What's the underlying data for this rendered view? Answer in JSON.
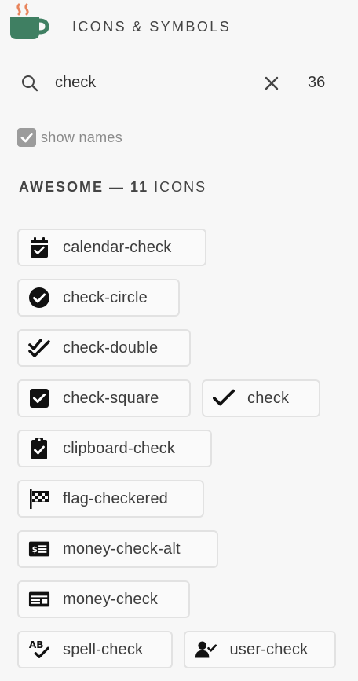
{
  "header": {
    "title": "ICONS & SYMBOLS",
    "logo_icon": "coffee-cup-icon"
  },
  "search": {
    "value": "check",
    "placeholder": "",
    "size": "36"
  },
  "options": {
    "show_names_label": "show names",
    "show_names_checked": true
  },
  "section": {
    "set_name": "AWESOME",
    "separator": "—",
    "count_label": "11",
    "unit": "ICONS"
  },
  "colors": {
    "logo_cup": "#3f7f62",
    "logo_steam": "#e8845c",
    "checkbox": "#9c9c9c"
  },
  "icons": [
    {
      "name": "calendar-check",
      "icon": "calendar-check-icon"
    },
    {
      "name": "check-circle",
      "icon": "check-circle-icon"
    },
    {
      "name": "check-double",
      "icon": "check-double-icon"
    },
    {
      "name": "check-square",
      "icon": "check-square-icon"
    },
    {
      "name": "check",
      "icon": "check-icon"
    },
    {
      "name": "clipboard-check",
      "icon": "clipboard-check-icon"
    },
    {
      "name": "flag-checkered",
      "icon": "flag-checkered-icon"
    },
    {
      "name": "money-check-alt",
      "icon": "money-check-alt-icon"
    },
    {
      "name": "money-check",
      "icon": "money-check-icon"
    },
    {
      "name": "spell-check",
      "icon": "spell-check-icon"
    },
    {
      "name": "user-check",
      "icon": "user-check-icon"
    }
  ]
}
